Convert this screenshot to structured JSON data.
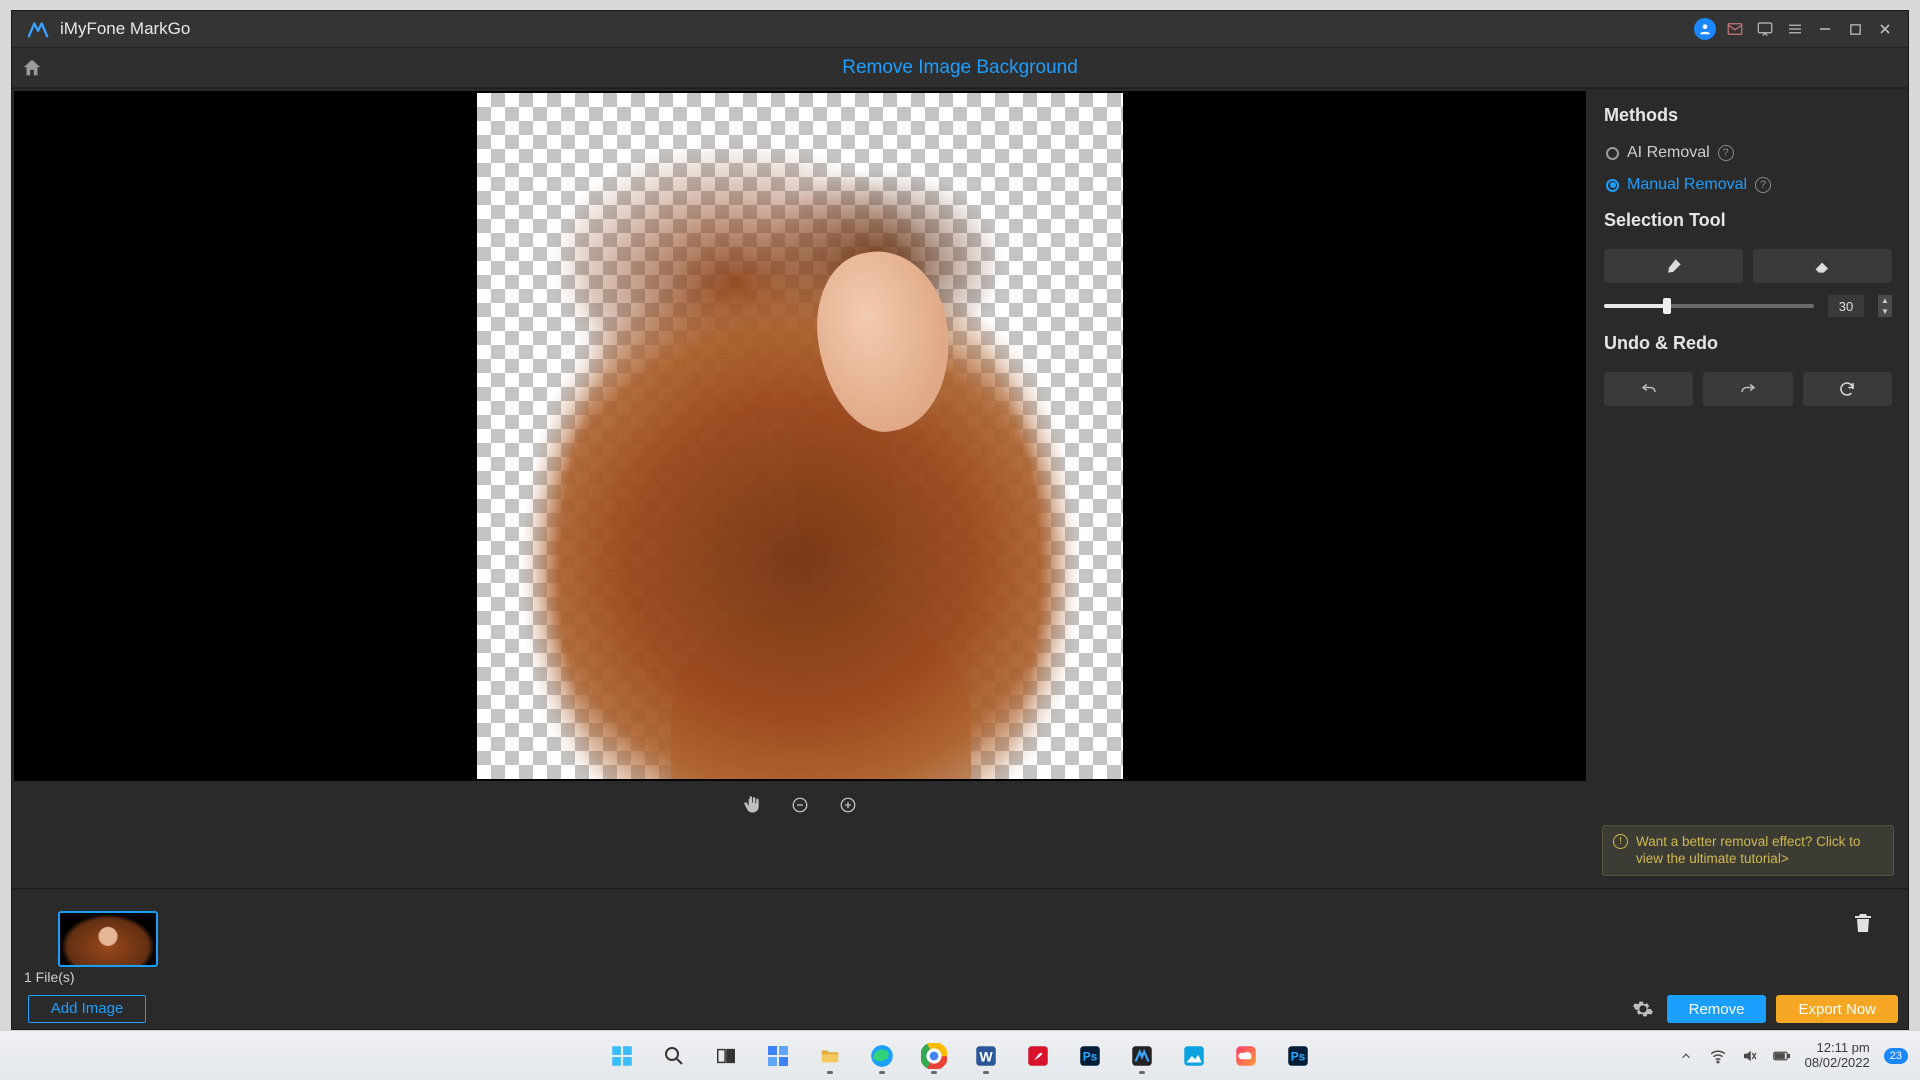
{
  "titlebar": {
    "app_name": "iMyFone MarkGo"
  },
  "page": {
    "title": "Remove Image Background"
  },
  "side": {
    "methods_heading": "Methods",
    "ai_label": "AI Removal",
    "manual_label": "Manual Removal",
    "selection_heading": "Selection Tool",
    "brush_size": "30",
    "undo_heading": "Undo & Redo",
    "tip_text": "Want a better removal effect? Click to view the ultimate tutorial>"
  },
  "files": {
    "count_label": "1 File(s)",
    "add_label": "Add Image"
  },
  "actions": {
    "remove": "Remove",
    "export": "Export Now"
  },
  "taskbar": {
    "time": "12:11 pm",
    "date": "08/02/2022",
    "notif_count": "23"
  },
  "slider": {
    "percent": 30
  }
}
